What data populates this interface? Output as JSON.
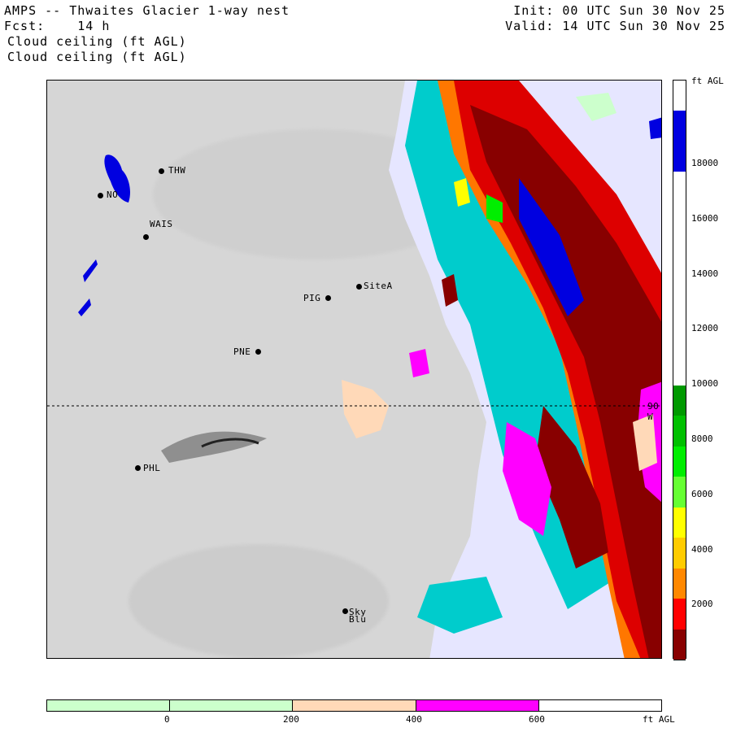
{
  "header": {
    "title": "AMPS -- Thwaites Glacier 1-way nest",
    "forecast": "Fcst:    14 h",
    "field1": "Cloud ceiling (ft AGL)",
    "field2": "Cloud ceiling (ft AGL)",
    "init": "Init: 00 UTC Sun 30 Nov 25",
    "valid": "Valid: 14 UTC Sun 30 Nov 25"
  },
  "stations": [
    {
      "name": "THW"
    },
    {
      "name": "NO"
    },
    {
      "name": "WAIS"
    },
    {
      "name": "SiteA"
    },
    {
      "name": "PIG"
    },
    {
      "name": "PNE"
    },
    {
      "name": "PHL"
    },
    {
      "name": "Sky"
    },
    {
      "name": "Blu"
    }
  ],
  "meridian_label": "90 W",
  "vertical_colorbar": {
    "unit": "ft AGL",
    "ticks": [
      "18000",
      "16000",
      "14000",
      "12000",
      "10000",
      "8000",
      "6000",
      "4000",
      "2000"
    ],
    "colors": [
      "#ffffff",
      "#0000e0",
      "#0000e0",
      "#ffffff",
      "#ffffff",
      "#ffffff",
      "#ffffff",
      "#ffffff",
      "#ffffff",
      "#ffffff",
      "#009900",
      "#00c000",
      "#00ee00",
      "#66ff33",
      "#ffff00",
      "#ffcc00",
      "#ff8800",
      "#ff0000",
      "#880000"
    ]
  },
  "horizontal_colorbar": {
    "unit": "ft AGL",
    "ticks": [
      "0",
      "200",
      "400",
      "600"
    ],
    "colors": [
      "#ccffcc",
      "#ccffcc",
      "#ffd9b8",
      "#ff00ff",
      "#ffffff"
    ]
  }
}
